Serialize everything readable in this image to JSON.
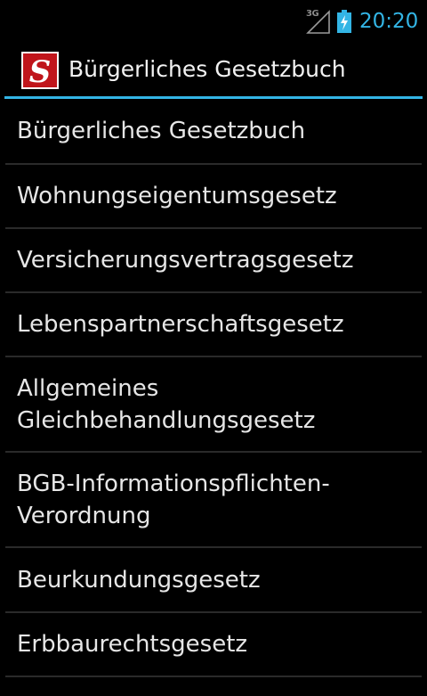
{
  "status_bar": {
    "network": "3G",
    "time": "20:20",
    "signal_icon": "signal-strength-icon",
    "battery_icon": "battery-charging-icon",
    "accent_color": "#33b5e5"
  },
  "action_bar": {
    "icon": "app-logo-section-icon",
    "title": "Bürgerliches Gesetzbuch",
    "divider_color": "#33b5e5"
  },
  "list": {
    "items": [
      {
        "label": "Bürgerliches Gesetzbuch"
      },
      {
        "label": "Wohnungseigentumsgesetz"
      },
      {
        "label": "Versicherungsvertragsgesetz"
      },
      {
        "label": "Lebenspartnerschaftsgesetz"
      },
      {
        "label": "Allgemeines Gleichbehandlungsgesetz"
      },
      {
        "label": "BGB-Informationspflichten-Verordnung"
      },
      {
        "label": "Beurkundungsgesetz"
      },
      {
        "label": "Erbbaurechtsgesetz"
      }
    ]
  }
}
